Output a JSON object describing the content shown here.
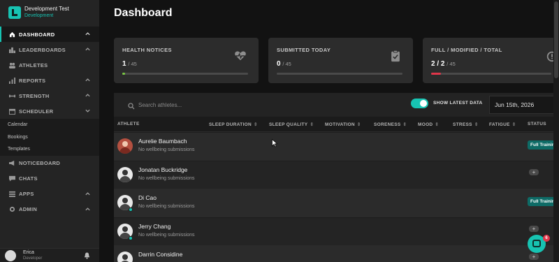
{
  "brand": {
    "title": "Development Test",
    "subtitle": "Development"
  },
  "nav": {
    "items": [
      {
        "label": "DASHBOARD",
        "icon": "home-icon",
        "active": true
      },
      {
        "label": "LEADERBOARDS",
        "icon": "leaderboard-icon"
      },
      {
        "label": "ATHLETES",
        "icon": "people-icon"
      },
      {
        "label": "REPORTS",
        "icon": "chart-icon"
      },
      {
        "label": "STRENGTH",
        "icon": "dumbbell-icon"
      },
      {
        "label": "SCHEDULER",
        "icon": "calendar-icon"
      }
    ],
    "scheduler_sub": [
      "Calendar",
      "Bookings",
      "Templates"
    ],
    "items_after": [
      {
        "label": "NOTICEBOARD",
        "icon": "megaphone-icon"
      },
      {
        "label": "CHATS",
        "icon": "chat-icon"
      },
      {
        "label": "APPS",
        "icon": "apps-icon"
      },
      {
        "label": "ADMIN",
        "icon": "admin-icon"
      }
    ]
  },
  "user": {
    "name": "Erica",
    "role": "Developer"
  },
  "page": {
    "title": "Dashboard"
  },
  "cards": [
    {
      "label": "HEALTH NOTICES",
      "value": "1",
      "total": "/ 45",
      "progress": 0.02,
      "color": "#7ac943",
      "icon": "heartbeat-icon"
    },
    {
      "label": "SUBMITTED TODAY",
      "value": "0",
      "total": "/ 45",
      "progress": 0.0,
      "color": "#7ac943",
      "icon": "clipboard-check-icon"
    },
    {
      "label": "FULL / MODIFIED / TOTAL",
      "value": "2 / 2",
      "total": "/ 45",
      "progress": 0.08,
      "color": "#e0364a",
      "icon": "alarm-icon"
    }
  ],
  "toolbar": {
    "search_placeholder": "Search athletes...",
    "toggle_label": "SHOW LATEST DATA",
    "toggle_on": true,
    "date": "Jun 15th, 2026"
  },
  "table": {
    "columns": [
      "ATHLETE",
      "SLEEP DURATION",
      "SLEEP QUALITY",
      "MOTIVATION",
      "SORENESS",
      "MOOD",
      "STRESS",
      "FATIGUE",
      "STATUS"
    ],
    "rows": [
      {
        "name": "Aurelie Baumbach",
        "sub": "No wellbeing submissions",
        "status": "Full Training",
        "online": false,
        "photo": true
      },
      {
        "name": "Jonatan Buckridge",
        "sub": "No wellbeing submissions",
        "status": "",
        "online": false,
        "photo": false
      },
      {
        "name": "Di Cao",
        "sub": "No wellbeing submissions",
        "status": "Full Training",
        "online": true,
        "photo": false
      },
      {
        "name": "Jerry Chang",
        "sub": "No wellbeing submissions",
        "status": "",
        "online": true,
        "photo": false
      },
      {
        "name": "Darrin Considine",
        "sub": "",
        "status": "",
        "online": false,
        "photo": false
      }
    ]
  },
  "chat": {
    "unread": "6"
  },
  "colors": {
    "accent": "#17c3b2",
    "danger": "#e0364a",
    "success": "#7ac943"
  }
}
